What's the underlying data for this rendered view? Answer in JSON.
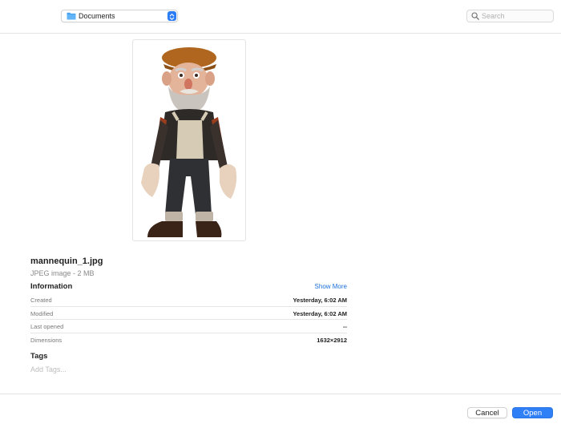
{
  "toolbar": {
    "location_label": "Documents",
    "location_icon": "folder-icon",
    "search_placeholder": "Search"
  },
  "preview": {
    "alt": "mannequin_1.jpg preview"
  },
  "file": {
    "name": "mannequin_1.jpg",
    "kind": "JPEG image - 2 MB"
  },
  "information": {
    "heading": "Information",
    "show_more": "Show More",
    "rows": [
      {
        "key": "Created",
        "value": "Yesterday, 6:02 AM"
      },
      {
        "key": "Modified",
        "value": "Yesterday, 6:02 AM"
      },
      {
        "key": "Last opened",
        "value": "--"
      },
      {
        "key": "Dimensions",
        "value": "1632×2912"
      }
    ]
  },
  "tags": {
    "heading": "Tags",
    "placeholder": "Add Tags..."
  },
  "footer": {
    "cancel_label": "Cancel",
    "open_label": "Open"
  },
  "colors": {
    "accent": "#2f7ff7",
    "link": "#1a6fd8",
    "folder": "#4aa3f0"
  }
}
